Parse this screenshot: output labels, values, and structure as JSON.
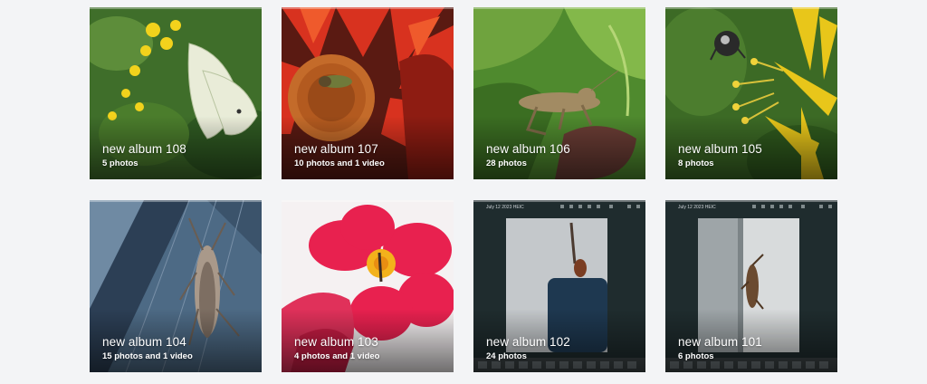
{
  "albums": [
    {
      "title": "new album 108",
      "count": "5 photos",
      "thumbnail": "white-butterfly-on-yellow-flowers"
    },
    {
      "title": "new album 107",
      "count": "10 photos and 1 video",
      "thumbnail": "bee-on-red-flower"
    },
    {
      "title": "new album 106",
      "count": "28 photos",
      "thumbnail": "grasshopper-on-leaf"
    },
    {
      "title": "new album 105",
      "count": "8 photos",
      "thumbnail": "beetle-on-yellow-flower"
    },
    {
      "title": "new album 104",
      "count": "15 photos and 1 video",
      "thumbnail": "grasshopper-on-blue-wood"
    },
    {
      "title": "new album 103",
      "count": "4 photos and 1 video",
      "thumbnail": "bee-on-pink-flower"
    },
    {
      "title": "new album 102",
      "count": "24 photos",
      "thumbnail": "screenshot-insect-on-wall",
      "screenshot_label": "July 12 2023 HEIC"
    },
    {
      "title": "new album 101",
      "count": "6 photos",
      "thumbnail": "screenshot-insect-on-wall",
      "screenshot_label": "July 12 2023 HEIC"
    }
  ],
  "colors": {
    "page_background": "#f3f4f6",
    "caption_text": "#ffffff"
  }
}
